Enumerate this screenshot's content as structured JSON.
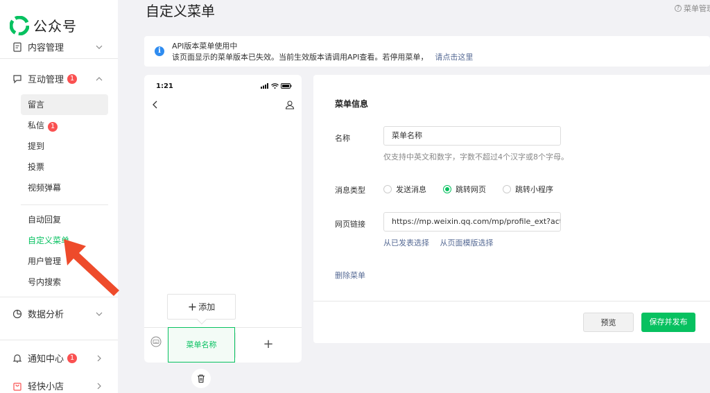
{
  "logo": {
    "text": "公众号"
  },
  "sidebar": {
    "groups": [
      {
        "label": "内容管理"
      },
      {
        "label": "互动管理",
        "badge": "1"
      },
      {
        "label": "数据分析"
      },
      {
        "label": "通知中心",
        "badge": "1"
      },
      {
        "label": "轻快小店"
      }
    ],
    "sub_items": [
      {
        "label": "留言"
      },
      {
        "label": "私信",
        "badge": "1"
      },
      {
        "label": "提到"
      },
      {
        "label": "投票"
      },
      {
        "label": "视频弹幕"
      },
      {
        "label": "自动回复"
      },
      {
        "label": "自定义菜单"
      },
      {
        "label": "用户管理"
      },
      {
        "label": "号内搜索"
      }
    ]
  },
  "header": {
    "title": "自定义菜单",
    "help": "菜单管理"
  },
  "notice": {
    "title": "API版本菜单使用中",
    "desc": "该页面显示的菜单版本已失效。当前生效版本请调用API查看。若停用菜单，",
    "link": "请点击这里"
  },
  "phone": {
    "time": "1:21",
    "add_label": "添加",
    "menu_tab": "菜单名称",
    "plus": "+"
  },
  "form": {
    "section_title": "菜单信息",
    "name_label": "名称",
    "name_value": "菜单名称",
    "name_hint": "仅支持中英文和数字，字数不超过4个汉字或8个字母。",
    "type_label": "消息类型",
    "type_options": [
      {
        "label": "发送消息",
        "checked": false
      },
      {
        "label": "跳转网页",
        "checked": true
      },
      {
        "label": "跳转小程序",
        "checked": false
      }
    ],
    "url_label": "网页链接",
    "url_value": "https://mp.weixin.qq.com/mp/profile_ext?action",
    "url_links": [
      "从已发表选择",
      "从页面模版选择"
    ],
    "delete_label": "删除菜单",
    "preview_button": "预览",
    "publish_button": "保存并发布"
  },
  "colors": {
    "accent": "#07c160",
    "link": "#576b95",
    "badge": "#fa5151",
    "info": "#2f8cf0",
    "arrow": "#ee4b2b"
  }
}
